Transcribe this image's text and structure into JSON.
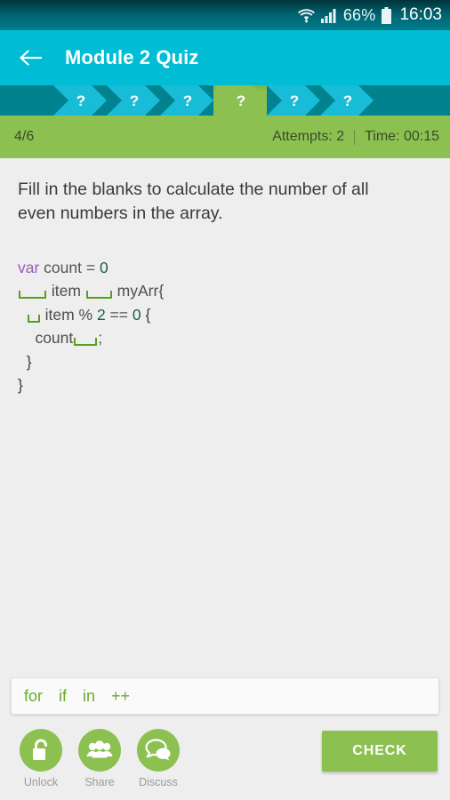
{
  "status_bar": {
    "wifi_icon": "wifi-icon",
    "signal_icon": "signal-bars-icon",
    "battery_percent": "66%",
    "battery_icon": "battery-icon",
    "clock": "16:03"
  },
  "app_bar": {
    "back_icon": "back-arrow-icon",
    "title": "Module 2 Quiz"
  },
  "progress": {
    "steps": [
      {
        "label": "?",
        "active": false
      },
      {
        "label": "?",
        "active": false
      },
      {
        "label": "?",
        "active": false
      },
      {
        "label": "?",
        "active": true
      },
      {
        "label": "?",
        "active": false
      },
      {
        "label": "?",
        "active": false
      }
    ],
    "counter": "4/6",
    "attempts_label": "Attempts: 2",
    "time_label": "Time: 00:15",
    "separator": "|"
  },
  "question": {
    "text": "Fill in the blanks to calculate the number of all even numbers in the array."
  },
  "code": {
    "lines": [
      {
        "tokens": [
          {
            "t": "var",
            "c": "k-var"
          },
          {
            "t": " count = ",
            "c": "k-op"
          },
          {
            "t": "0",
            "c": "k-num"
          }
        ]
      },
      {
        "tokens": [
          {
            "t": "",
            "c": "blank",
            "w": "w-lg"
          },
          {
            "t": " item ",
            "c": "k-id"
          },
          {
            "t": "",
            "c": "blank",
            "w": "w-md"
          },
          {
            "t": " myArr{",
            "c": "k-id"
          }
        ]
      },
      {
        "tokens": [
          {
            "t": "  ",
            "c": "k-op"
          },
          {
            "t": "",
            "c": "blank",
            "w": "w-sm"
          },
          {
            "t": " item % ",
            "c": "k-id"
          },
          {
            "t": "2",
            "c": "k-num"
          },
          {
            "t": " == ",
            "c": "k-op"
          },
          {
            "t": "0",
            "c": "k-num"
          },
          {
            "t": " {",
            "c": "k-brace"
          }
        ]
      },
      {
        "tokens": [
          {
            "t": "    count",
            "c": "k-id"
          },
          {
            "t": "",
            "c": "blank",
            "w": "w-xs"
          },
          {
            "t": ";",
            "c": "k-op"
          }
        ]
      },
      {
        "tokens": [
          {
            "t": "  }",
            "c": "k-brace"
          }
        ]
      },
      {
        "tokens": [
          {
            "t": "}",
            "c": "k-brace"
          }
        ]
      }
    ]
  },
  "word_bank": {
    "words": [
      "for",
      "if",
      "in",
      "++"
    ]
  },
  "bottom_bar": {
    "actions": [
      {
        "label": "Unlock",
        "icon": "padlock-icon"
      },
      {
        "label": "Share",
        "icon": "people-group-icon"
      },
      {
        "label": "Discuss",
        "icon": "speech-bubbles-icon"
      }
    ],
    "check_label": "CHECK"
  },
  "colors": {
    "accent_cyan": "#00bcd4",
    "accent_green": "#8cc152",
    "chevron_cyan": "#19bcd6",
    "strip_dark": "#00828f",
    "keyword_purple": "#9b59b6",
    "number_teal": "#1a5c52",
    "blank_green": "#5a9e1e",
    "word_green": "#6aab30",
    "page_bg": "#eeeeee"
  }
}
